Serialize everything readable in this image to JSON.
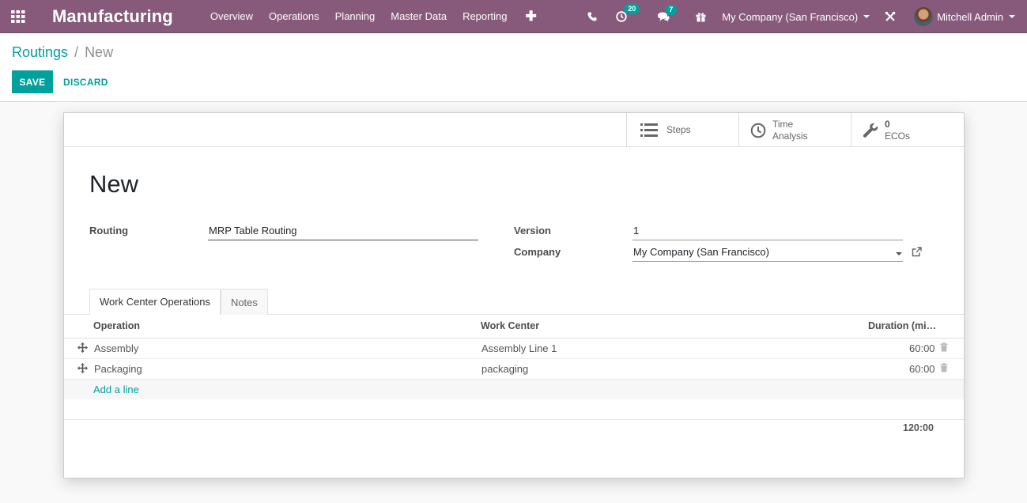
{
  "navbar": {
    "app_name": "Manufacturing",
    "menu": [
      "Overview",
      "Operations",
      "Planning",
      "Master Data",
      "Reporting"
    ],
    "activity_count": "20",
    "message_count": "7",
    "company": "My Company (San Francisco)",
    "user": "Mitchell Admin",
    "colors": {
      "bar": "#875a7b",
      "badge": "#00a09d"
    }
  },
  "breadcrumb": {
    "parent": "Routings",
    "separator": "/",
    "current": "New"
  },
  "buttons": {
    "save": "SAVE",
    "discard": "DISCARD"
  },
  "smart_buttons": {
    "steps": "Steps",
    "time_analysis": [
      "Time",
      "Analysis"
    ],
    "ecos_count": "0",
    "ecos_label": "ECOs"
  },
  "form": {
    "title": "New",
    "routing_label": "Routing",
    "routing_value": "MRP Table Routing",
    "version_label": "Version",
    "version_value": "1",
    "company_label": "Company",
    "company_value": "My Company (San Francisco)"
  },
  "tabs": [
    "Work Center Operations",
    "Notes"
  ],
  "table": {
    "headers": {
      "operation": "Operation",
      "work_center": "Work Center",
      "duration": "Duration (mi…"
    },
    "rows": [
      {
        "operation": "Assembly",
        "work_center": "Assembly Line 1",
        "duration": "60:00"
      },
      {
        "operation": "Packaging",
        "work_center": "packaging",
        "duration": "60:00"
      }
    ],
    "add_line": "Add a line",
    "total": "120:00"
  }
}
